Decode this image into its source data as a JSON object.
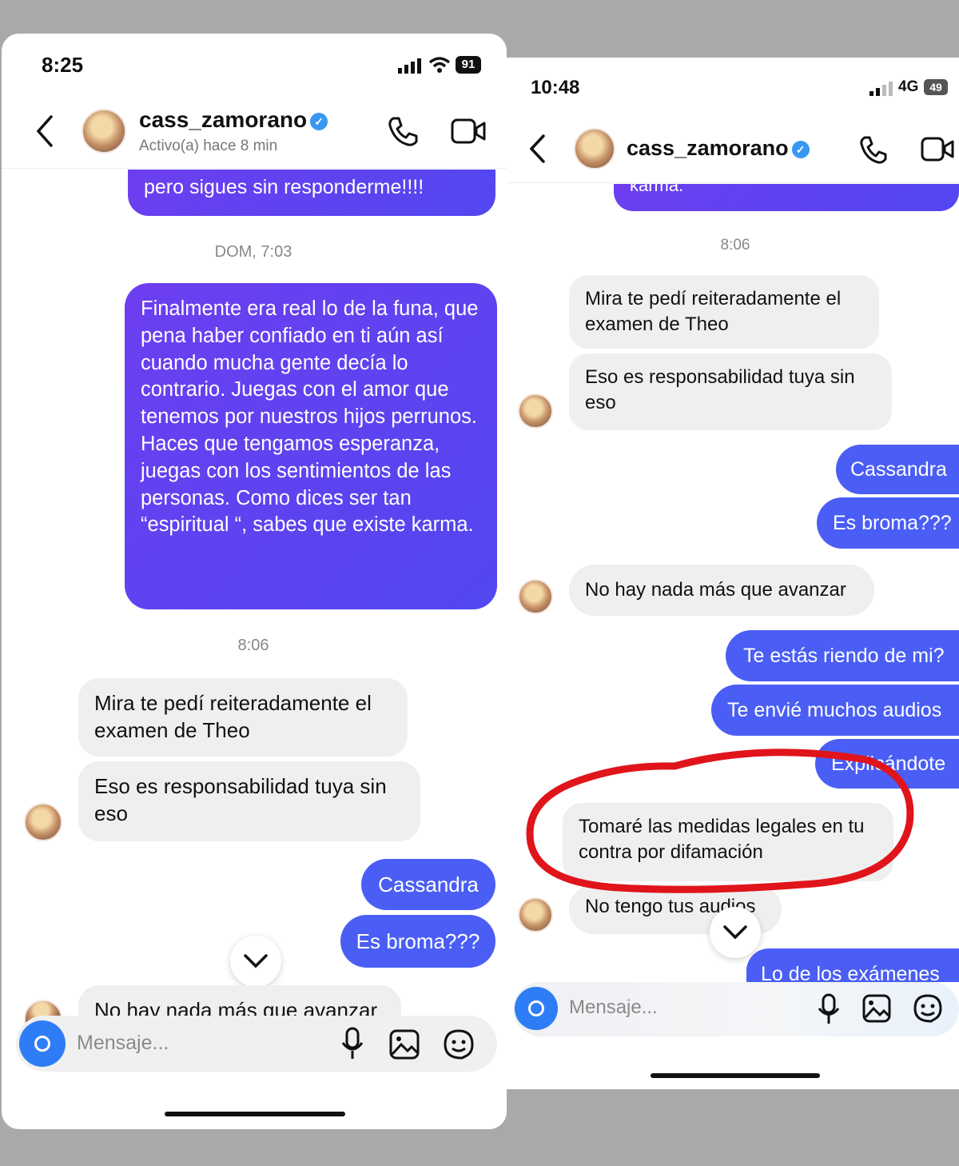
{
  "left": {
    "status_time": "8:25",
    "battery": "91",
    "username": "cass_zamorano",
    "activity": "Activo(a) hace 8 min",
    "partial_top": "pero sigues sin responderme!!!!",
    "stamp1": "DOM, 7:03",
    "big_message": "Finalmente era real lo de la funa, que pena haber confiado en ti aún así cuando mucha gente decía lo contrario. Juegas con el amor que tenemos por nuestros hijos perrunos.\nHaces que tengamos esperanza, juegas con los sentimientos de las personas. Como dices ser tan “espiritual “, sabes que existe karma.",
    "stamp2": "8:06",
    "in1": "Mira te pedí reiteradamente el examen de Theo",
    "in2": "Eso es responsabilidad tuya sin eso",
    "out1": "Cassandra",
    "out2": "Es broma???",
    "partial_bottom": "No hay nada más que avanzar",
    "placeholder": "Mensaje..."
  },
  "right": {
    "status_time": "10:48",
    "network": "4G",
    "battery": "49",
    "username": "cass_zamorano",
    "partial_top": "karma.",
    "stamp": "8:06",
    "in1": "Mira te pedí reiteradamente el examen de Theo",
    "in2": "Eso es responsabilidad tuya sin eso",
    "out1": "Cassandra",
    "out2": "Es broma???",
    "in3": "No hay nada más que avanzar",
    "out3": "Te estás riendo de mi?",
    "out4": "Te envié muchos audios",
    "out5": "Explicándote",
    "in4": "Tomaré las medidas legales en tu contra por difamación",
    "in5": "No tengo tus audios",
    "out6": "Lo de los exámenes",
    "placeholder": "Mensaje..."
  },
  "colors": {
    "outgoing": "#4a5ef5",
    "incoming": "#efefef",
    "highlight_circle": "#e0141b",
    "verified": "#3897f0"
  }
}
